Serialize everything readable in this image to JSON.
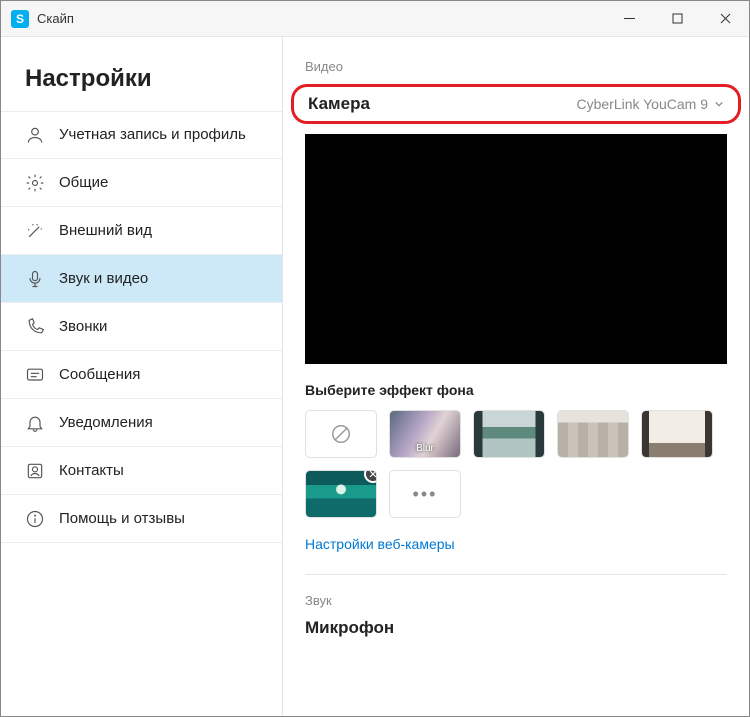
{
  "titlebar": {
    "app_letter": "S",
    "title": "Скайп"
  },
  "sidebar": {
    "title": "Настройки",
    "items": [
      {
        "label": "Учетная запись и профиль"
      },
      {
        "label": "Общие"
      },
      {
        "label": "Внешний вид"
      },
      {
        "label": "Звук и видео"
      },
      {
        "label": "Звонки"
      },
      {
        "label": "Сообщения"
      },
      {
        "label": "Уведомления"
      },
      {
        "label": "Контакты"
      },
      {
        "label": "Помощь и отзывы"
      }
    ]
  },
  "main": {
    "video_section": "Видео",
    "camera_label": "Камера",
    "camera_value": "CyberLink YouCam 9",
    "effect_header": "Выберите эффект фона",
    "blur_label": "Blur",
    "more_label": "•••",
    "webcam_link": "Настройки веб-камеры",
    "audio_section": "Звук",
    "mic_label": "Микрофон"
  }
}
